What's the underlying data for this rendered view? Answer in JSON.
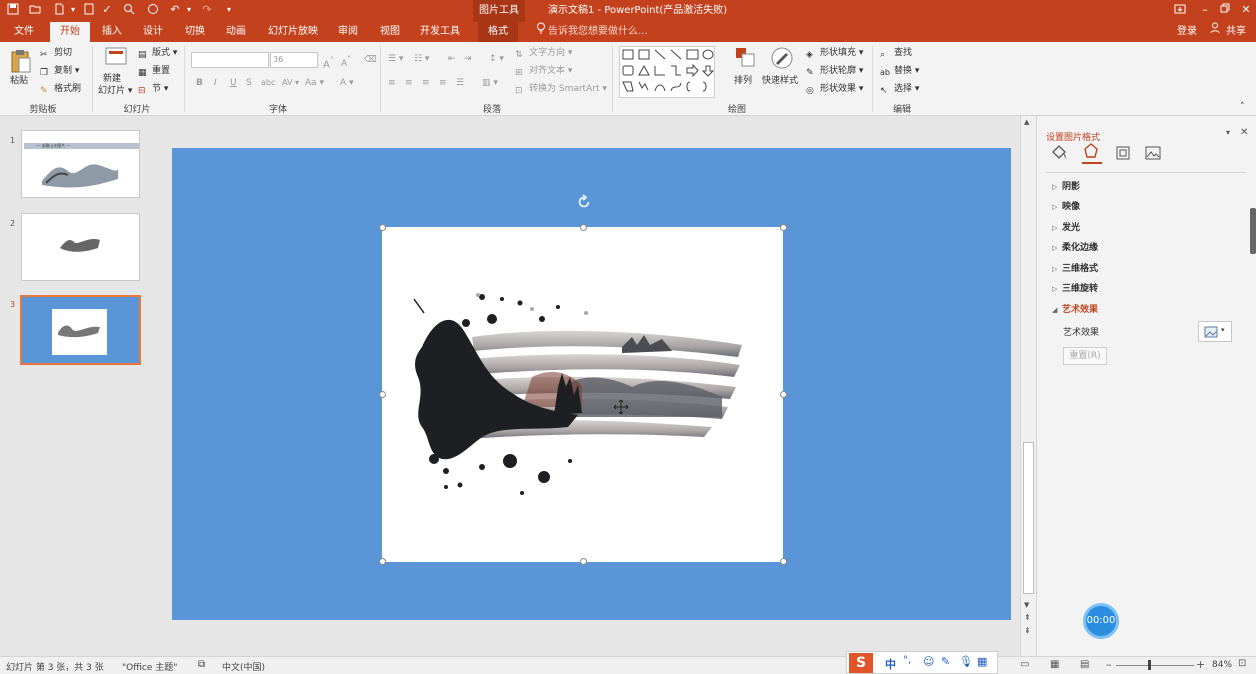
{
  "titlebar": {
    "context_tool": "图片工具",
    "title": "演示文稿1 - PowerPoint(产品激活失败)"
  },
  "tabs": [
    {
      "label": "文件"
    },
    {
      "label": "开始"
    },
    {
      "label": "插入"
    },
    {
      "label": "设计"
    },
    {
      "label": "切换"
    },
    {
      "label": "动画"
    },
    {
      "label": "幻灯片放映"
    },
    {
      "label": "审阅"
    },
    {
      "label": "视图"
    },
    {
      "label": "开发工具"
    },
    {
      "label": "格式"
    }
  ],
  "tell_me": "告诉我您想要做什么...",
  "account": {
    "login": "登录",
    "share": "共享"
  },
  "ribbon": {
    "clipboard": {
      "paste": "粘贴",
      "cut": "剪切",
      "copy": "复制",
      "format_painter": "格式刷",
      "label": "剪贴板"
    },
    "slides": {
      "new_slide_1": "新建",
      "new_slide_2": "幻灯片",
      "layout": "版式",
      "reset": "重置",
      "section": "节",
      "label": "幻灯片"
    },
    "font": {
      "name_value": "",
      "size_value": "36",
      "label": "字体"
    },
    "paragraph": {
      "text_direction": "文字方向",
      "align_text": "对齐文本",
      "smartart": "转换为 SmartArt",
      "label": "段落"
    },
    "drawing": {
      "arrange": "排列",
      "quick_styles": "快速样式",
      "shape_fill": "形状填充",
      "shape_outline": "形状轮廓",
      "shape_effects": "形状效果",
      "label": "绘图"
    },
    "editing": {
      "find": "查找",
      "replace": "替换",
      "select": "选择",
      "label": "编辑"
    }
  },
  "slides": [
    {
      "number": "1",
      "thumb_title": "—  淡雅山水图片  —"
    },
    {
      "number": "2"
    },
    {
      "number": "3"
    }
  ],
  "format_pane": {
    "title": "设置图片格式",
    "sections": [
      {
        "label": "阴影",
        "expanded": false
      },
      {
        "label": "映像",
        "expanded": false
      },
      {
        "label": "发光",
        "expanded": false
      },
      {
        "label": "柔化边缘",
        "expanded": false
      },
      {
        "label": "三维格式",
        "expanded": false
      },
      {
        "label": "三维旋转",
        "expanded": false
      },
      {
        "label": "艺术效果",
        "expanded": true
      }
    ],
    "artistic_label": "艺术效果",
    "reset_button": "重置(R)"
  },
  "statusbar": {
    "slide_info": "幻灯片 第 3 张，共 3 张",
    "theme": "\"Office 主题\"",
    "language": "中文(中国)",
    "zoom": "84%"
  },
  "ime": {
    "mode": "中"
  },
  "timer": "00:00",
  "colors": {
    "accent": "#c3411d",
    "slide_bg": "#5a96d7",
    "timer": "#2b8de0"
  }
}
